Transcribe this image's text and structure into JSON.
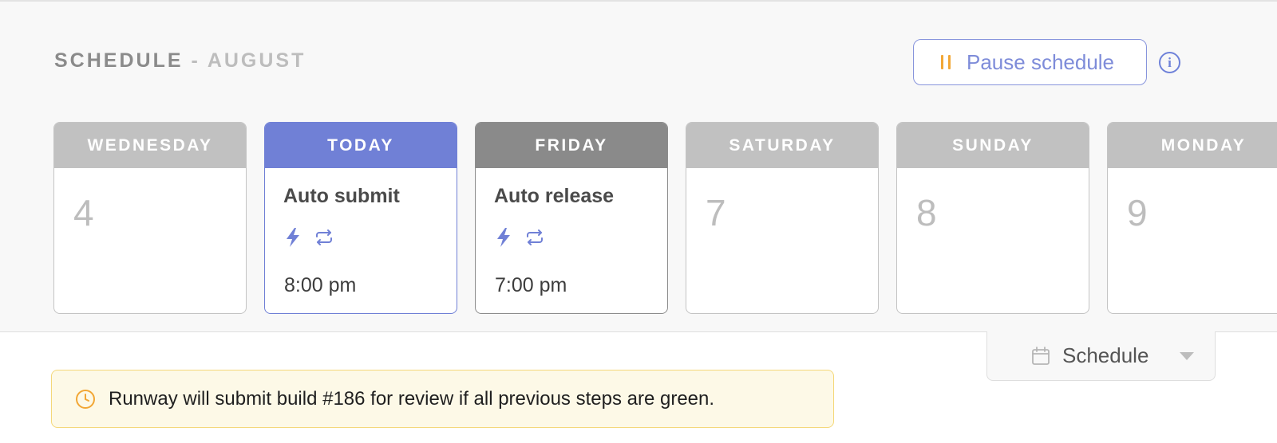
{
  "header": {
    "title": "SCHEDULE",
    "separator": "-",
    "month": "AUGUST"
  },
  "pause_button": {
    "label": "Pause schedule",
    "icon": "pause-icon"
  },
  "info_button": {
    "icon": "info-icon",
    "glyph": "i"
  },
  "days": [
    {
      "label": "WEDNESDAY",
      "number": "4"
    },
    {
      "label": "TODAY",
      "event": "Auto submit",
      "time": "8:00 pm",
      "icons": [
        "lightning-icon",
        "repeat-icon"
      ]
    },
    {
      "label": "FRIDAY",
      "event": "Auto release",
      "time": "7:00 pm",
      "icons": [
        "lightning-icon",
        "repeat-icon"
      ]
    },
    {
      "label": "SATURDAY",
      "number": "7"
    },
    {
      "label": "SUNDAY",
      "number": "8"
    },
    {
      "label": "MONDAY",
      "number": "9"
    }
  ],
  "schedule_tab": {
    "label": "Schedule",
    "icon": "calendar-icon"
  },
  "banner": {
    "text": "Runway will submit build #186 for review if all previous steps are green.",
    "icon": "clock-icon"
  },
  "colors": {
    "accent": "#7080d6",
    "pause_icon": "#f2a735",
    "banner_bg": "#fdf9e7",
    "banner_border": "#f4d87a"
  }
}
